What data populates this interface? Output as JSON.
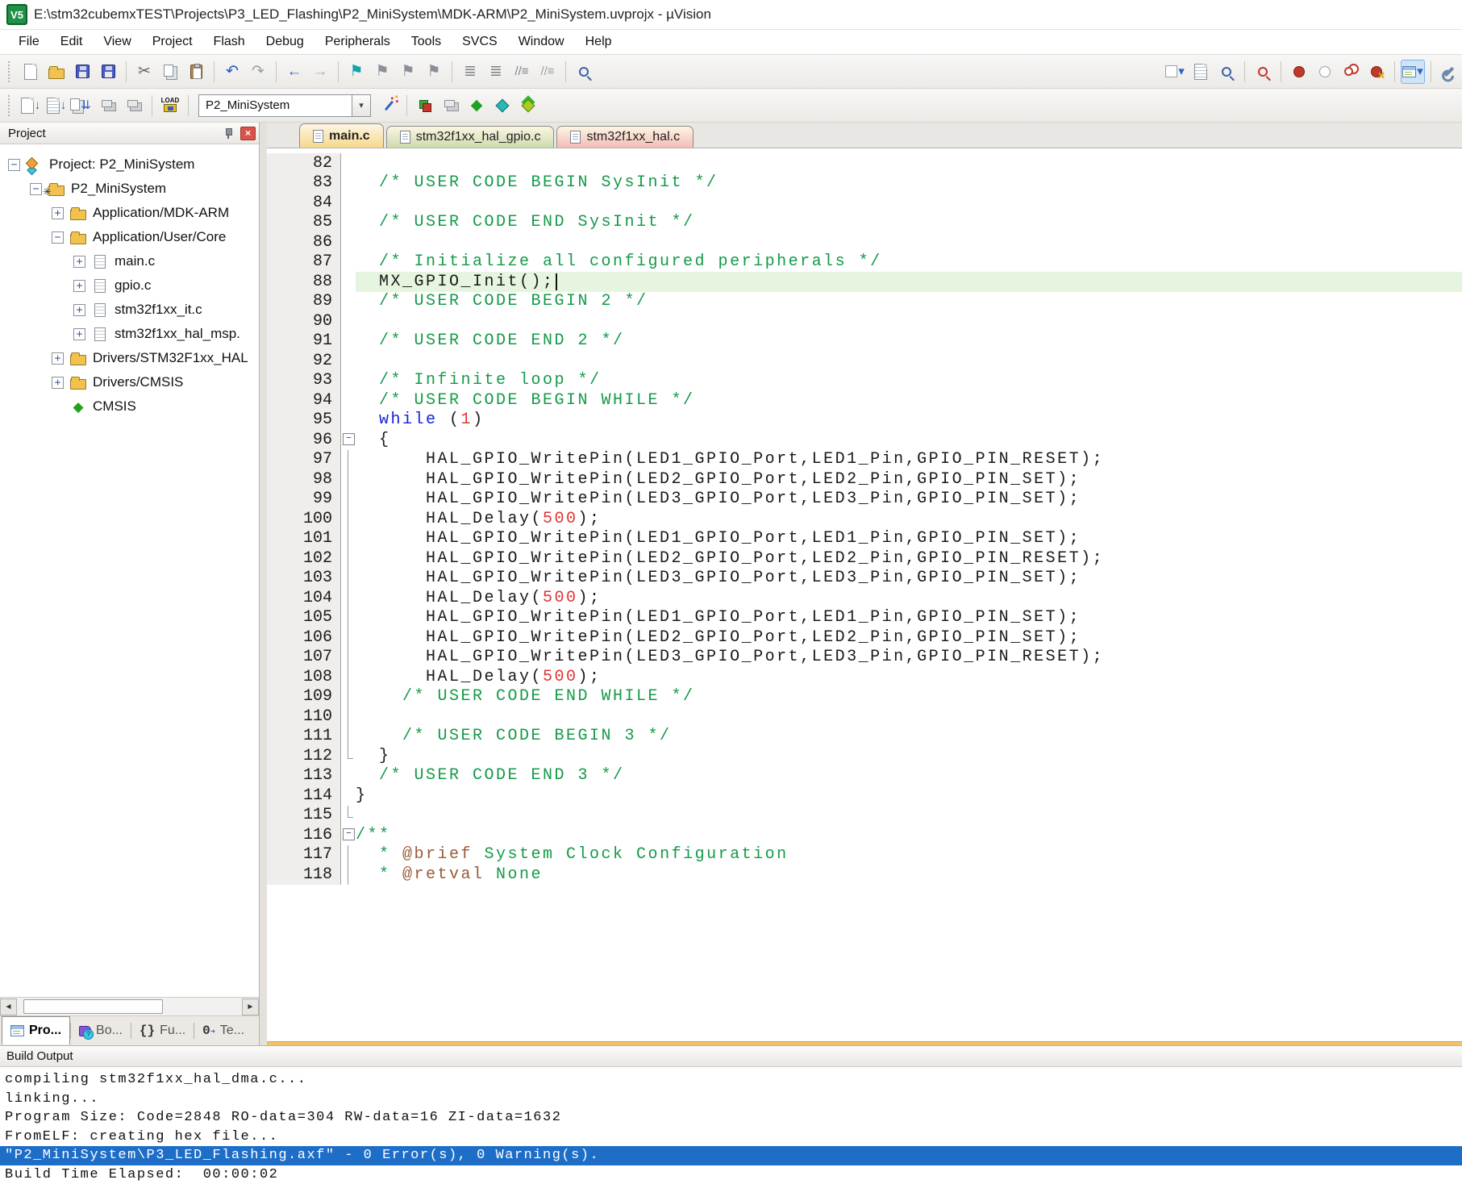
{
  "window": {
    "title": "E:\\stm32cubemxTEST\\Projects\\P3_LED_Flashing\\P2_MiniSystem\\MDK-ARM\\P2_MiniSystem.uvprojx - µVision",
    "logo_text": "V5"
  },
  "menu": [
    "File",
    "Edit",
    "View",
    "Project",
    "Flash",
    "Debug",
    "Peripherals",
    "Tools",
    "SVCS",
    "Window",
    "Help"
  ],
  "toolbar1": [
    {
      "name": "new-file-button",
      "kind": "doc"
    },
    {
      "name": "open-file-button",
      "kind": "folder"
    },
    {
      "name": "save-button",
      "kind": "floppy"
    },
    {
      "name": "save-all-button",
      "kind": "floppy floppy2"
    },
    {
      "sep": true
    },
    {
      "name": "cut-button",
      "g": "✂",
      "c": "#5a6068"
    },
    {
      "name": "copy-button",
      "kind": "copy"
    },
    {
      "name": "paste-button",
      "kind": "paste"
    },
    {
      "sep": true
    },
    {
      "name": "undo-button",
      "g": "↶",
      "c": "#2457c5"
    },
    {
      "name": "redo-button",
      "g": "↷",
      "c": "#9aa0a6"
    },
    {
      "sep": true
    },
    {
      "name": "navigate-back-button",
      "g": "←",
      "c": "#2e6bd6"
    },
    {
      "name": "navigate-forward-button",
      "g": "→",
      "c": "#aab0b6"
    },
    {
      "sep": true
    },
    {
      "name": "insert-bookmark-button",
      "g": "⚑",
      "c": "#12a3ad"
    },
    {
      "name": "previous-bookmark-button",
      "g": "⚑",
      "c": "#8a8f98"
    },
    {
      "name": "next-bookmark-button",
      "g": "⚑",
      "c": "#8a8f98"
    },
    {
      "name": "clear-bookmarks-button",
      "g": "⚑",
      "c": "#8a8f98"
    },
    {
      "sep": true
    },
    {
      "name": "outdent-button",
      "g": "≣",
      "c": "#7a8288"
    },
    {
      "name": "indent-button",
      "g": "≣",
      "c": "#7a8288"
    },
    {
      "name": "comment-selection-button",
      "g": "//≡",
      "c": "#7a8288",
      "small": true
    },
    {
      "name": "uncomment-selection-button",
      "g": "//≡",
      "c": "#9aa0a6",
      "small": true
    },
    {
      "sep": true
    },
    {
      "name": "find-in-files-button",
      "kind": "mag"
    },
    {
      "spacer": true
    },
    {
      "name": "debug-target-checkbox",
      "kind": "checkdd",
      "g2": "▾"
    },
    {
      "name": "find-in-document-button",
      "kind": "doc lined"
    },
    {
      "name": "incremental-find-button",
      "kind": "mag"
    },
    {
      "sep": true
    },
    {
      "name": "show-current-statement-button",
      "kind": "mag red"
    },
    {
      "sep": true
    },
    {
      "name": "toggle-breakpoint-button",
      "kind": "bp"
    },
    {
      "name": "enable-disable-breakpoint-button",
      "kind": "bpo"
    },
    {
      "name": "disable-all-breakpoints-button",
      "kind": "bp2"
    },
    {
      "name": "kill-all-breakpoints-button",
      "kind": "bpx"
    },
    {
      "sep": true
    },
    {
      "name": "windows-layout-button",
      "kind": "grid",
      "g2": "▾",
      "hl": true
    },
    {
      "sep": true
    },
    {
      "name": "configure-wrench-button",
      "kind": "wrench"
    }
  ],
  "toolbar2": {
    "left_icons": [
      {
        "name": "translate-button",
        "kind": "doc",
        "g2": "↓"
      },
      {
        "name": "build-button",
        "kind": "doc lined",
        "g2": "↓"
      },
      {
        "name": "rebuild-button",
        "kind": "copy",
        "g2": "⇊"
      },
      {
        "name": "batch-build-button",
        "kind": "stack"
      },
      {
        "name": "stop-build-button",
        "kind": "stack"
      },
      {
        "sep": true
      },
      {
        "name": "download-button",
        "kind": "load",
        "label": "LOAD"
      },
      {
        "sep": true
      }
    ],
    "target": "P2_MiniSystem",
    "dropdown_glyph": "▾",
    "right_icons": [
      {
        "name": "options-for-target-button",
        "kind": "wand"
      },
      {
        "sep": true
      },
      {
        "name": "manage-rte-button",
        "kind": "rte"
      },
      {
        "name": "file-extensions-button",
        "kind": "stack"
      },
      {
        "name": "pack-installer-button",
        "g": "◆",
        "c": "#21a121"
      },
      {
        "name": "select-software-packs-button",
        "kind": "tri2"
      },
      {
        "name": "manage-components-button",
        "kind": "tri3"
      }
    ]
  },
  "project_panel": {
    "title": "Project",
    "tree": [
      {
        "label": "Project: P2_MiniSystem",
        "depth": 0,
        "expander": "minus",
        "icon": "target"
      },
      {
        "label": "P2_MiniSystem",
        "depth": 1,
        "expander": "minus",
        "icon": "tfolder"
      },
      {
        "label": "Application/MDK-ARM",
        "depth": 2,
        "expander": "plus",
        "icon": "folder"
      },
      {
        "label": "Application/User/Core",
        "depth": 2,
        "expander": "minus",
        "icon": "folder"
      },
      {
        "label": "main.c",
        "depth": 3,
        "expander": "plus",
        "icon": "cfile"
      },
      {
        "label": "gpio.c",
        "depth": 3,
        "expander": "plus",
        "icon": "cfile"
      },
      {
        "label": "stm32f1xx_it.c",
        "depth": 3,
        "expander": "plus",
        "icon": "cfile"
      },
      {
        "label": "stm32f1xx_hal_msp.",
        "depth": 3,
        "expander": "plus",
        "icon": "cfile"
      },
      {
        "label": "Drivers/STM32F1xx_HAL",
        "depth": 2,
        "expander": "plus",
        "icon": "folder"
      },
      {
        "label": "Drivers/CMSIS",
        "depth": 2,
        "expander": "plus",
        "icon": "folder"
      },
      {
        "label": "CMSIS",
        "depth": 2,
        "expander": "none",
        "icon": "diamond"
      }
    ],
    "bottom_tabs": [
      {
        "label": "Pro...",
        "icon": "grid",
        "active": true
      },
      {
        "label": "Bo...",
        "icon": "books",
        "active": false
      },
      {
        "label": "Fu...",
        "icon": "braces",
        "active": false
      },
      {
        "label": "Te...",
        "icon": "braces-arrow",
        "active": false
      }
    ],
    "braces_glyph": "{}",
    "braces_arrow_glyph": "0"
  },
  "editor": {
    "tabs": [
      {
        "label": "main.c",
        "active": true,
        "color": "#f6d98c"
      },
      {
        "label": "stm32f1xx_hal_gpio.c",
        "active": false,
        "color": "#cbdcac"
      },
      {
        "label": "stm32f1xx_hal.c",
        "active": false,
        "color": "#f3bcb8"
      }
    ],
    "syntax_colors": {
      "comment": "#149a48",
      "keyword": "#1622d8",
      "number": "#e03434",
      "doc_tag": "#9a5a38",
      "plain": "#1a1a1a",
      "current_line_bg": "#e6f5df"
    },
    "lines": [
      {
        "n": 82,
        "seg": []
      },
      {
        "n": 83,
        "seg": [
          [
            "c",
            "  /* USER CODE BEGIN SysInit */"
          ]
        ]
      },
      {
        "n": 84,
        "seg": []
      },
      {
        "n": 85,
        "seg": [
          [
            "c",
            "  /* USER CODE END SysInit */"
          ]
        ]
      },
      {
        "n": 86,
        "seg": []
      },
      {
        "n": 87,
        "seg": [
          [
            "c",
            "  /* Initialize all configured peripherals */"
          ]
        ]
      },
      {
        "n": 88,
        "hl": true,
        "caret": true,
        "seg": [
          [
            "p",
            "  MX_GPIO_Init();"
          ]
        ]
      },
      {
        "n": 89,
        "seg": [
          [
            "c",
            "  /* USER CODE BEGIN 2 */"
          ]
        ]
      },
      {
        "n": 90,
        "seg": []
      },
      {
        "n": 91,
        "seg": [
          [
            "c",
            "  /* USER CODE END 2 */"
          ]
        ]
      },
      {
        "n": 92,
        "seg": []
      },
      {
        "n": 93,
        "seg": [
          [
            "c",
            "  /* Infinite loop */"
          ]
        ]
      },
      {
        "n": 94,
        "seg": [
          [
            "c",
            "  /* USER CODE BEGIN WHILE */"
          ]
        ]
      },
      {
        "n": 95,
        "seg": [
          [
            "p",
            "  "
          ],
          [
            "k",
            "while"
          ],
          [
            "p",
            " ("
          ],
          [
            "nu",
            "1"
          ],
          [
            "p",
            ")"
          ]
        ]
      },
      {
        "n": 96,
        "fold": "minus",
        "seg": [
          [
            "p",
            "  {"
          ]
        ]
      },
      {
        "n": 97,
        "fold": "line",
        "seg": [
          [
            "p",
            "      HAL_GPIO_WritePin(LED1_GPIO_Port,LED1_Pin,GPIO_PIN_RESET);"
          ]
        ]
      },
      {
        "n": 98,
        "fold": "line",
        "seg": [
          [
            "p",
            "      HAL_GPIO_WritePin(LED2_GPIO_Port,LED2_Pin,GPIO_PIN_SET);"
          ]
        ]
      },
      {
        "n": 99,
        "fold": "line",
        "seg": [
          [
            "p",
            "      HAL_GPIO_WritePin(LED3_GPIO_Port,LED3_Pin,GPIO_PIN_SET);"
          ]
        ]
      },
      {
        "n": 100,
        "fold": "line",
        "seg": [
          [
            "p",
            "      HAL_Delay("
          ],
          [
            "nu",
            "500"
          ],
          [
            "p",
            ");"
          ]
        ]
      },
      {
        "n": 101,
        "fold": "line",
        "seg": [
          [
            "p",
            "      HAL_GPIO_WritePin(LED1_GPIO_Port,LED1_Pin,GPIO_PIN_SET);"
          ]
        ]
      },
      {
        "n": 102,
        "fold": "line",
        "seg": [
          [
            "p",
            "      HAL_GPIO_WritePin(LED2_GPIO_Port,LED2_Pin,GPIO_PIN_RESET);"
          ]
        ]
      },
      {
        "n": 103,
        "fold": "line",
        "seg": [
          [
            "p",
            "      HAL_GPIO_WritePin(LED3_GPIO_Port,LED3_Pin,GPIO_PIN_SET);"
          ]
        ]
      },
      {
        "n": 104,
        "fold": "line",
        "seg": [
          [
            "p",
            "      HAL_Delay("
          ],
          [
            "nu",
            "500"
          ],
          [
            "p",
            ");"
          ]
        ]
      },
      {
        "n": 105,
        "fold": "line",
        "seg": [
          [
            "p",
            "      HAL_GPIO_WritePin(LED1_GPIO_Port,LED1_Pin,GPIO_PIN_SET);"
          ]
        ]
      },
      {
        "n": 106,
        "fold": "line",
        "seg": [
          [
            "p",
            "      HAL_GPIO_WritePin(LED2_GPIO_Port,LED2_Pin,GPIO_PIN_SET);"
          ]
        ]
      },
      {
        "n": 107,
        "fold": "line",
        "seg": [
          [
            "p",
            "      HAL_GPIO_WritePin(LED3_GPIO_Port,LED3_Pin,GPIO_PIN_RESET);"
          ]
        ]
      },
      {
        "n": 108,
        "fold": "line",
        "seg": [
          [
            "p",
            "      HAL_Delay("
          ],
          [
            "nu",
            "500"
          ],
          [
            "p",
            ");"
          ]
        ]
      },
      {
        "n": 109,
        "fold": "line",
        "seg": [
          [
            "c",
            "    /* USER CODE END WHILE */"
          ]
        ]
      },
      {
        "n": 110,
        "fold": "line",
        "seg": []
      },
      {
        "n": 111,
        "fold": "line",
        "seg": [
          [
            "c",
            "    /* USER CODE BEGIN 3 */"
          ]
        ]
      },
      {
        "n": 112,
        "fold": "end",
        "seg": [
          [
            "p",
            "  }"
          ]
        ]
      },
      {
        "n": 113,
        "seg": [
          [
            "c",
            "  /* USER CODE END 3 */"
          ]
        ]
      },
      {
        "n": 114,
        "seg": [
          [
            "p",
            "}"
          ]
        ]
      },
      {
        "n": 115,
        "fold": "end",
        "seg": []
      },
      {
        "n": 116,
        "fold": "minus",
        "seg": [
          [
            "c",
            "/**"
          ]
        ]
      },
      {
        "n": 117,
        "fold": "line",
        "seg": [
          [
            "c",
            "  * "
          ],
          [
            "t",
            "@brief"
          ],
          [
            "c",
            " System Clock Configuration"
          ]
        ]
      },
      {
        "n": 118,
        "fold": "line",
        "seg": [
          [
            "c",
            "  * "
          ],
          [
            "t",
            "@retval"
          ],
          [
            "c",
            " None"
          ]
        ]
      }
    ]
  },
  "build_output": {
    "title": "Build Output",
    "selection_color": "#1e6ec8",
    "lines": [
      {
        "text": "compiling stm32f1xx_hal_dma.c...",
        "selected": false
      },
      {
        "text": "linking...",
        "selected": false
      },
      {
        "text": "Program Size: Code=2848 RO-data=304 RW-data=16 ZI-data=1632",
        "selected": false
      },
      {
        "text": "FromELF: creating hex file...",
        "selected": false
      },
      {
        "text": "\"P2_MiniSystem\\P3_LED_Flashing.axf\" - 0 Error(s), 0 Warning(s).",
        "selected": true
      },
      {
        "text": "Build Time Elapsed:  00:00:02",
        "selected": false
      }
    ]
  }
}
